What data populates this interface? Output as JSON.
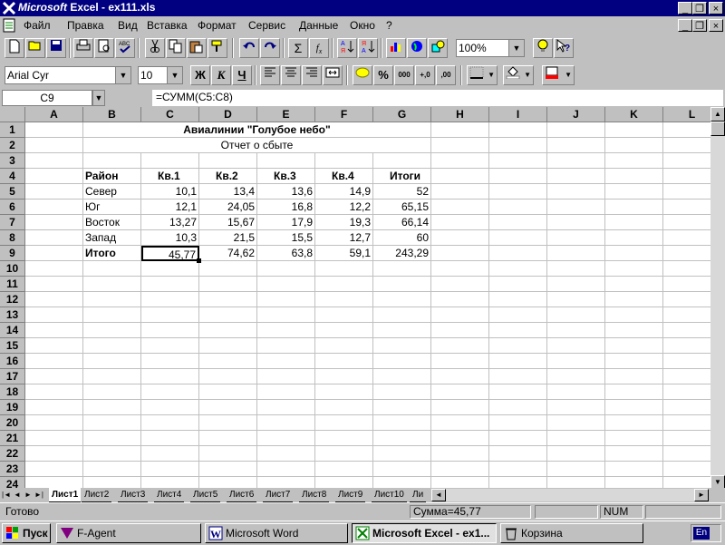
{
  "window": {
    "title_brand": "Microsoft",
    "title_rest": " Excel - ex111.xls",
    "min": "_",
    "restore": "❐",
    "close": "×"
  },
  "menu": [
    "Файл",
    "Правка",
    "Вид",
    "Вставка",
    "Формат",
    "Сервис",
    "Данные",
    "Окно",
    "?"
  ],
  "toolbar1": {
    "zoom": "100%",
    "icons": [
      "new-icon",
      "open-icon",
      "save-icon",
      "print-icon",
      "preview-icon",
      "spell-icon",
      "cut-icon",
      "copy-icon",
      "paste-icon",
      "format-painter-icon",
      "undo-icon",
      "redo-icon",
      "autosum-icon",
      "function-icon",
      "sort-asc-icon",
      "sort-desc-icon",
      "chart-wizard-icon",
      "map-icon",
      "drawing-icon",
      "tip-icon",
      "help-icon"
    ]
  },
  "toolbar2": {
    "font": "Arial Cyr",
    "size": "10",
    "bold": "Ж",
    "italic": "К",
    "underline": "Ч",
    "percent": "%",
    "thousands": "000",
    "inc_decimal": "+,0",
    "dec_decimal": ",00"
  },
  "formula_bar": {
    "name_box": "C9",
    "formula": "=СУММ(C5:C8)"
  },
  "columns": [
    "A",
    "B",
    "C",
    "D",
    "E",
    "F",
    "G",
    "H",
    "I",
    "J",
    "K",
    "L"
  ],
  "rows": [
    "1",
    "2",
    "3",
    "4",
    "5",
    "6",
    "7",
    "8",
    "9",
    "10",
    "11",
    "12",
    "13",
    "14",
    "15",
    "16",
    "17",
    "18",
    "19",
    "20",
    "21",
    "22",
    "23",
    "24"
  ],
  "sheet": {
    "title": "Авиалинии \"Голубое небо\"",
    "subtitle": "Отчет о сбыте",
    "header": [
      "Район",
      "Кв.1",
      "Кв.2",
      "Кв.3",
      "Кв.4",
      "Итоги"
    ],
    "data": [
      [
        "Север",
        "10,1",
        "13,4",
        "13,6",
        "14,9",
        "52"
      ],
      [
        "Юг",
        "12,1",
        "24,05",
        "16,8",
        "12,2",
        "65,15"
      ],
      [
        "Восток",
        "13,27",
        "15,67",
        "17,9",
        "19,3",
        "66,14"
      ],
      [
        "Запад",
        "10,3",
        "21,5",
        "15,5",
        "12,7",
        "60"
      ]
    ],
    "total": [
      "Итого",
      "45,77",
      "74,62",
      "63,8",
      "59,1",
      "243,29"
    ]
  },
  "sheet_tabs": [
    "Лист1",
    "Лист2",
    "Лист3",
    "Лист4",
    "Лист5",
    "Лист6",
    "Лист7",
    "Лист8",
    "Лист9",
    "Лист10",
    "Ли"
  ],
  "status": {
    "ready": "Готово",
    "sum": "Сумма=45,77",
    "num": "NUM"
  },
  "taskbar": {
    "start": "Пуск",
    "tasks": [
      "F-Agent",
      "Microsoft Word",
      "Microsoft Excel - ex1...",
      "Корзина"
    ],
    "lang": "En"
  }
}
